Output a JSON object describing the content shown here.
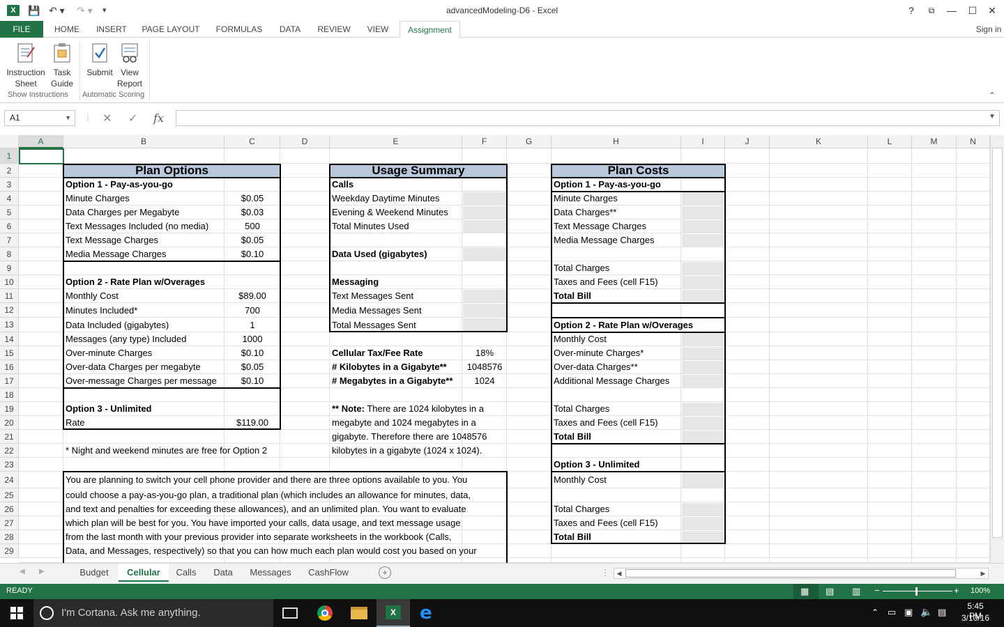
{
  "titlebar": {
    "title": "advancedModeling-D6 - Excel",
    "logo": "X",
    "help": "?",
    "restore_ribbon": "⧉",
    "minimize": "—",
    "maximize": "☐",
    "close": "✕"
  },
  "ribbon_tabs": [
    "FILE",
    "HOME",
    "INSERT",
    "PAGE LAYOUT",
    "FORMULAS",
    "DATA",
    "REVIEW",
    "VIEW",
    "Assignment"
  ],
  "sign_in": "Sign in",
  "ribbon": {
    "instruction_sheet": [
      "Instruction",
      "Sheet"
    ],
    "task_guide": [
      "Task",
      "Guide"
    ],
    "submit": "Submit",
    "view_report": [
      "View",
      "Report"
    ],
    "group1": "Show Instructions",
    "group2": "Automatic Scoring"
  },
  "formula_bar": {
    "name_box": "A1",
    "fx": "fx",
    "value": ""
  },
  "columns": [
    "A",
    "B",
    "C",
    "D",
    "E",
    "F",
    "G",
    "H",
    "I",
    "J",
    "K",
    "L",
    "M",
    "N"
  ],
  "rows": [
    "1",
    "2",
    "3",
    "4",
    "5",
    "6",
    "7",
    "8",
    "9",
    "10",
    "11",
    "12",
    "13",
    "14",
    "15",
    "16",
    "17",
    "18",
    "19",
    "20",
    "21",
    "22",
    "23",
    "24",
    "25",
    "26",
    "27",
    "28",
    "29"
  ],
  "plan_options": {
    "header": "Plan Options",
    "opt1": "Option 1 - Pay-as-you-go",
    "rows1": [
      [
        "Minute Charges",
        "$0.05"
      ],
      [
        "Data Charges per Megabyte",
        "$0.03"
      ],
      [
        "Text Messages Included (no media)",
        "500"
      ],
      [
        "Text Message Charges",
        "$0.05"
      ],
      [
        "Media Message Charges",
        "$0.10"
      ]
    ],
    "opt2": "Option 2 - Rate Plan w/Overages",
    "rows2": [
      [
        "Monthly Cost",
        "$89.00"
      ],
      [
        "Minutes Included*",
        "700"
      ],
      [
        "Data Included (gigabytes)",
        "1"
      ],
      [
        "Messages (any type) Included",
        "1000"
      ],
      [
        "Over-minute Charges",
        "$0.10"
      ],
      [
        "Over-data Charges per megabyte",
        "$0.05"
      ],
      [
        "Over-message Charges per message",
        "$0.10"
      ]
    ],
    "opt3": "Option 3 - Unlimited",
    "rows3": [
      [
        "Rate",
        "$119.00"
      ]
    ],
    "footnote": "* Night and weekend minutes are free for Option 2"
  },
  "usage": {
    "header": "Usage Summary",
    "calls": "Calls",
    "calls_rows": [
      "Weekday Daytime Minutes",
      "Evening & Weekend Minutes",
      "Total Minutes Used"
    ],
    "data": "Data Used (gigabytes)",
    "messaging": "Messaging",
    "msg_rows": [
      "Text Messages Sent",
      "Media Messages Sent",
      "Total Messages Sent"
    ],
    "tax_label": "Cellular Tax/Fee Rate",
    "tax_value": "18%",
    "kb_label": "# Kilobytes in a Gigabyte**",
    "kb_value": "1048576",
    "mb_label": "# Megabytes in a Gigabyte**",
    "mb_value": "1024",
    "note_bold": "** Note:",
    "note_lines": [
      " There are 1024 kilobytes in a",
      "megabyte and 1024 megabytes in a",
      "gigabyte. Therefore there are 1048576",
      "kilobytes in a gigabyte (1024 x 1024)."
    ]
  },
  "plan_costs": {
    "header": "Plan Costs",
    "opt1": "Option 1 - Pay-as-you-go",
    "rows1": [
      "Minute Charges",
      "Data Charges**",
      "Text Message Charges",
      "Media Message Charges"
    ],
    "totals1": [
      "Total Charges",
      "Taxes and Fees (cell F15)",
      "Total Bill"
    ],
    "opt2": "Option 2 - Rate Plan w/Overages",
    "rows2": [
      "Monthly Cost",
      "Over-minute Charges*",
      "Over-data Charges**",
      "Additional Message Charges"
    ],
    "totals2": [
      "Total Charges",
      "Taxes and Fees (cell F15)",
      "Total Bill"
    ],
    "opt3": "Option 3 - Unlimited",
    "rows3": [
      "Monthly Cost"
    ],
    "totals3": [
      "Total Charges",
      "Taxes and Fees (cell F15)",
      "Total Bill"
    ]
  },
  "description_lines": [
    "You are planning to switch your cell phone provider and there are three options available to you. You",
    "could choose a pay-as-you-go plan, a traditional plan (which includes an allowance for minutes, data,",
    "and text and penalties for exceeding these allowances), and an unlimited plan. You want to evaluate",
    "which plan will be best for you. You have imported your calls, data usage, and text message usage",
    "from the last month with your previous provider into separate worksheets in the workbook (Calls,",
    "Data, and Messages, respectively) so that you can how much each plan would cost you based on your"
  ],
  "sheets": [
    "Budget",
    "Cellular",
    "Calls",
    "Data",
    "Messages",
    "CashFlow"
  ],
  "status": {
    "ready": "READY",
    "zoom": "100%"
  },
  "taskbar": {
    "cortana": "I'm Cortana. Ask me anything.",
    "time": "5:45 PM",
    "date": "3/10/16"
  },
  "colors": {
    "excel_green": "#217346",
    "header_blue": "#b8c7da",
    "input_gray": "#e6e6e6"
  }
}
